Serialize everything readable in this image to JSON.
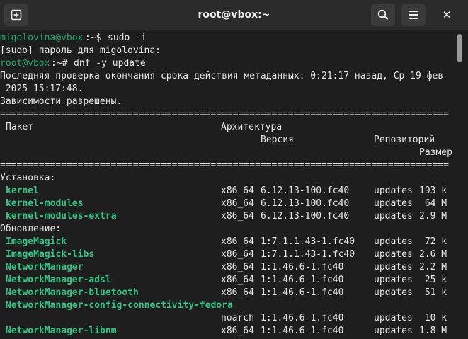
{
  "window": {
    "title": "root@vbox:~",
    "icons": {
      "new_tab": "plus-square-icon",
      "search": "search-icon",
      "menu": "hamburger-menu-icon",
      "close": "close-icon"
    },
    "close_glyph": "✕"
  },
  "colors": {
    "prompt_green": "#26a269",
    "package_green": "#33c285",
    "background": "#1e1e1e",
    "titlebar": "#2b2b2b"
  },
  "terminal": {
    "prompt1": {
      "user_host": "migolovina@vbox",
      "sep": ":~$ ",
      "cmd": "sudo -i"
    },
    "sudo_prompt": "[sudo] пароль для migolovina:",
    "prompt2": {
      "user_host": "root@vbox",
      "sep": ":~# ",
      "cmd": "dnf -y update"
    },
    "meta_line1": "Последняя проверка окончания срока действия метаданных: 0:21:17 назад, Ср 19 фев",
    "meta_line2": " 2025 15:17:48.",
    "deps": "Зависимости разрешены.",
    "rule": "=================================================================================",
    "header": {
      "package": "Пакет",
      "arch": "Архитектура",
      "version": "Версия",
      "repo": "Репозиторий",
      "size": "Размер"
    },
    "section_install": "Установка:",
    "section_update": "Обновление:",
    "install_rows": [
      {
        "name": "kernel",
        "arch": "x86_64",
        "version": "6.12.13-100.fc40",
        "repo": "updates",
        "size": "193 k"
      },
      {
        "name": "kernel-modules",
        "arch": "x86_64",
        "version": "6.12.13-100.fc40",
        "repo": "updates",
        "size": " 64 M"
      },
      {
        "name": "kernel-modules-extra",
        "arch": "x86_64",
        "version": "6.12.13-100.fc40",
        "repo": "updates",
        "size": "2.9 M"
      }
    ],
    "update_rows": [
      {
        "name": "ImageMagick",
        "arch": "x86_64",
        "version": "1:7.1.1.43-1.fc40",
        "repo": "updates",
        "size": " 72 k"
      },
      {
        "name": "ImageMagick-libs",
        "arch": "x86_64",
        "version": "1:7.1.1.43-1.fc40",
        "repo": "updates",
        "size": "2.6 M"
      },
      {
        "name": "NetworkManager",
        "arch": "x86_64",
        "version": "1:1.46.6-1.fc40",
        "repo": "updates",
        "size": "2.2 M"
      },
      {
        "name": "NetworkManager-adsl",
        "arch": "x86_64",
        "version": "1:1.46.6-1.fc40",
        "repo": "updates",
        "size": " 25 k"
      },
      {
        "name": "NetworkManager-bluetooth",
        "arch": "x86_64",
        "version": "1:1.46.6-1.fc40",
        "repo": "updates",
        "size": " 51 k"
      }
    ],
    "long_row": {
      "name": "NetworkManager-config-connectivity-fedora",
      "arch": "noarch",
      "version": "1:1.46.6-1.fc40",
      "repo": "updates",
      "size": " 10 k"
    },
    "last_row": {
      "name": "NetworkManager-libnm",
      "arch": "x86_64",
      "version": "1:1.46.6-1.fc40",
      "repo": "updates",
      "size": "1.8 M"
    }
  }
}
